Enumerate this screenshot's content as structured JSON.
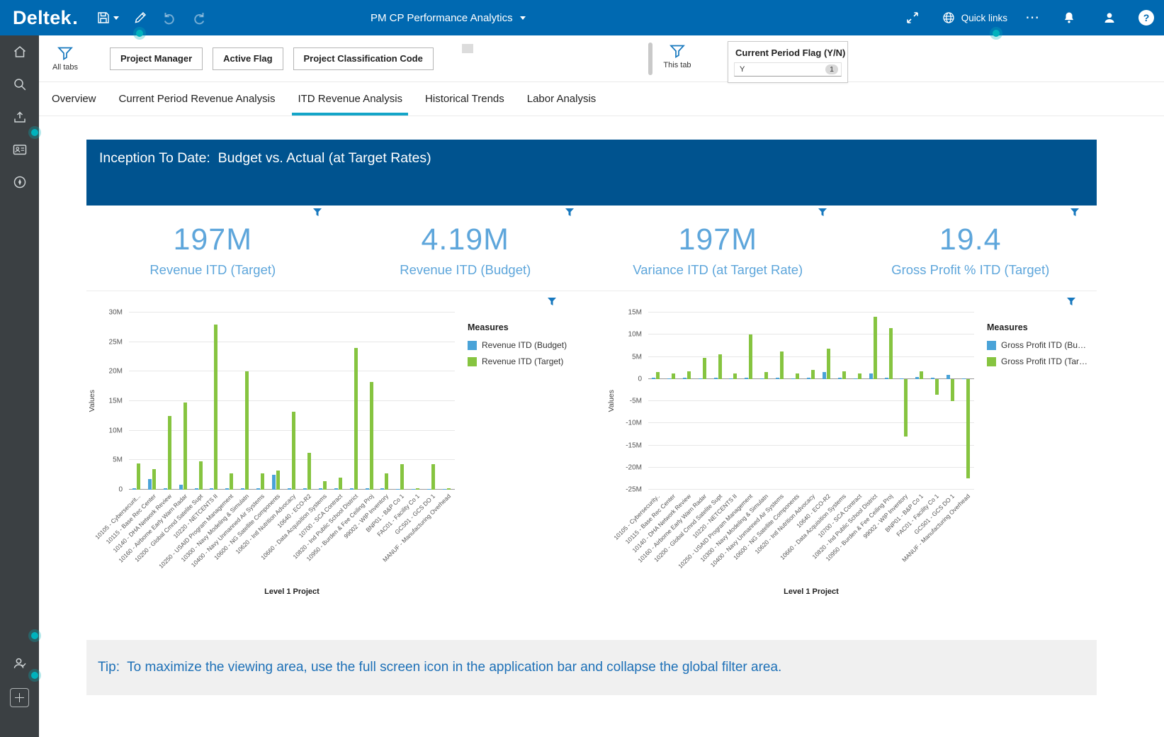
{
  "app": {
    "brand": "Deltek",
    "title": "PM CP Performance Analytics",
    "quick_links_label": "Quick links",
    "more_label": "⋯",
    "help_label": "?"
  },
  "filter_bar": {
    "all_tabs_label": "All tabs",
    "this_tab_label": "This tab",
    "chips": [
      {
        "label": "Project Manager"
      },
      {
        "label": "Active Flag"
      },
      {
        "label": "Project Classification Code"
      }
    ],
    "current_period_filter": {
      "label": "Current Period Flag (Y/N)",
      "value": "Y",
      "count": "1"
    }
  },
  "tabs": [
    {
      "label": "Overview",
      "active": false
    },
    {
      "label": "Current Period Revenue Analysis",
      "active": false
    },
    {
      "label": "ITD Revenue Analysis",
      "active": true
    },
    {
      "label": "Historical Trends",
      "active": false
    },
    {
      "label": "Labor Analysis",
      "active": false
    }
  ],
  "banner_title": "Inception To Date:  Budget vs. Actual (at Target Rates)",
  "kpis": [
    {
      "value": "197M",
      "label": "Revenue ITD (Target)"
    },
    {
      "value": "4.19M",
      "label": "Revenue ITD (Budget)"
    },
    {
      "value": "197M",
      "label": "Variance ITD (at Target Rate)"
    },
    {
      "value": "19.4",
      "label": "Gross Profit % ITD (Target)"
    }
  ],
  "tip": "Tip:  To maximize the viewing area, use the full screen icon in the application bar and collapse the global filter area.",
  "colors": {
    "topbar_blue": "#0069b1",
    "banner_blue": "#00538f",
    "accent_teal": "#14a5c8",
    "kpi_text_blue": "#5ea6db",
    "bar_blue": "#4aa3d8",
    "bar_green": "#86c440",
    "beacon_teal": "#00b2bd",
    "tip_text_blue": "#1d70b7"
  },
  "chart_data": [
    {
      "type": "bar",
      "title": "",
      "xlabel": "Level 1 Project",
      "ylabel": "Values",
      "legend_title": "Measures",
      "legend_position": "right",
      "grid": true,
      "ylim_millions": [
        0,
        30
      ],
      "yticks": [
        0,
        5,
        10,
        15,
        20,
        25,
        30
      ],
      "ytick_labels": [
        "0",
        "5M",
        "10M",
        "15M",
        "20M",
        "25M",
        "30M"
      ],
      "categories": [
        "10105 - Cybersecurit...",
        "10115 - Base Rec Center",
        "10140 - DHA Network Review",
        "10160 - Airborne Early Warn Radar",
        "10200 - Global Cmnd Satelite Supt",
        "10220 - NETCENTS II",
        "10250 - USAID Program Management",
        "10300 - Navy Modeling & Simulatn",
        "10400 - Navy Unmanned Air Systems",
        "10600 - NG Satellite Components",
        "10620 - Intl Nutrition Advocacy",
        "10640 - ECO-R2",
        "10660 - Data Acquisition Systems",
        "10700 - SCA Contract",
        "10820 - Ind Public School District",
        "10950 - Burden & Fee Ceiling Proj",
        "99002 - WIP Inventory",
        "BNP01 - B&P Co 1",
        "FAC01 - Facility Co 1",
        "GCS01 - GCS DO 1",
        "MANUF - Manufacturing Overhead"
      ],
      "series": [
        {
          "name": "Revenue ITD (Budget)",
          "color": "#4aa3d8",
          "values_millions": [
            0.3,
            1.8,
            0.2,
            0.9,
            0.2,
            0.3,
            0.2,
            0.3,
            0.2,
            2.5,
            0.3,
            0.2,
            0.2,
            0.2,
            0.3,
            0.2,
            0.2,
            0.1,
            0.1,
            0.1,
            0.1
          ]
        },
        {
          "name": "Revenue ITD (Target)",
          "color": "#86c440",
          "values_millions": [
            4.5,
            3.5,
            12.5,
            14.8,
            4.8,
            28,
            2.8,
            20,
            2.8,
            3.2,
            13.2,
            6.3,
            1.5,
            2.0,
            24,
            18.3,
            2.8,
            4.3,
            0.2,
            4.3,
            0.2
          ]
        }
      ]
    },
    {
      "type": "bar",
      "title": "",
      "xlabel": "Level 1 Project",
      "ylabel": "Values",
      "legend_title": "Measures",
      "legend_position": "right",
      "grid": true,
      "ylim_millions": [
        -25,
        15
      ],
      "yticks": [
        -25,
        -20,
        -15,
        -10,
        -5,
        0,
        5,
        10,
        15
      ],
      "ytick_labels": [
        "-25M",
        "-20M",
        "-15M",
        "-10M",
        "-5M",
        "0",
        "5M",
        "10M",
        "15M"
      ],
      "categories": [
        "10105 - Cybersecurity..",
        "10115 - Base Rec Center",
        "10140 - DHA Network Review",
        "10160 - Airborne Early Warn Radar",
        "10200 - Global Cmnd Satelite Supt",
        "10220 - NETCENTS II",
        "10250 - USAID Program Management",
        "10300 - Navy Modeling & Simulatn",
        "10400 - Navy Unmanned Air Systems",
        "10600 - NG Satellite Components",
        "10620 - Intl Nutrition Advocacy",
        "10640 - ECO-R2",
        "10660 - Data Acquisition Systems",
        "10700 - SCA Contract",
        "10820 - Ind Public School District",
        "10950 - Burden & Fee Ceiling Proj",
        "99002 - WIP Inventory",
        "BNP01 - B&P Co 1",
        "FAC01 - Facility Co 1",
        "GCS01 - GCS DO 1",
        "MANUF - Manufacturing Overhead"
      ],
      "series": [
        {
          "name": "Gross Profit ITD (Bu…",
          "color": "#4aa3d8",
          "values_millions": [
            0.3,
            0.2,
            0.3,
            0.2,
            0.3,
            0.2,
            0.3,
            0.2,
            0.3,
            0.2,
            0.3,
            1.5,
            0.3,
            0.2,
            1.2,
            0.3,
            0.2,
            0.4,
            0.3,
            0.9,
            0.2
          ]
        },
        {
          "name": "Gross Profit ITD (Tar…",
          "color": "#86c440",
          "values_millions": [
            1.5,
            1.2,
            1.8,
            4.8,
            5.5,
            1.2,
            10,
            1.5,
            6.2,
            1.3,
            2.0,
            6.8,
            1.8,
            1.2,
            14,
            11.5,
            -13,
            1.8,
            -3.5,
            -5,
            -22.5
          ]
        }
      ]
    }
  ]
}
